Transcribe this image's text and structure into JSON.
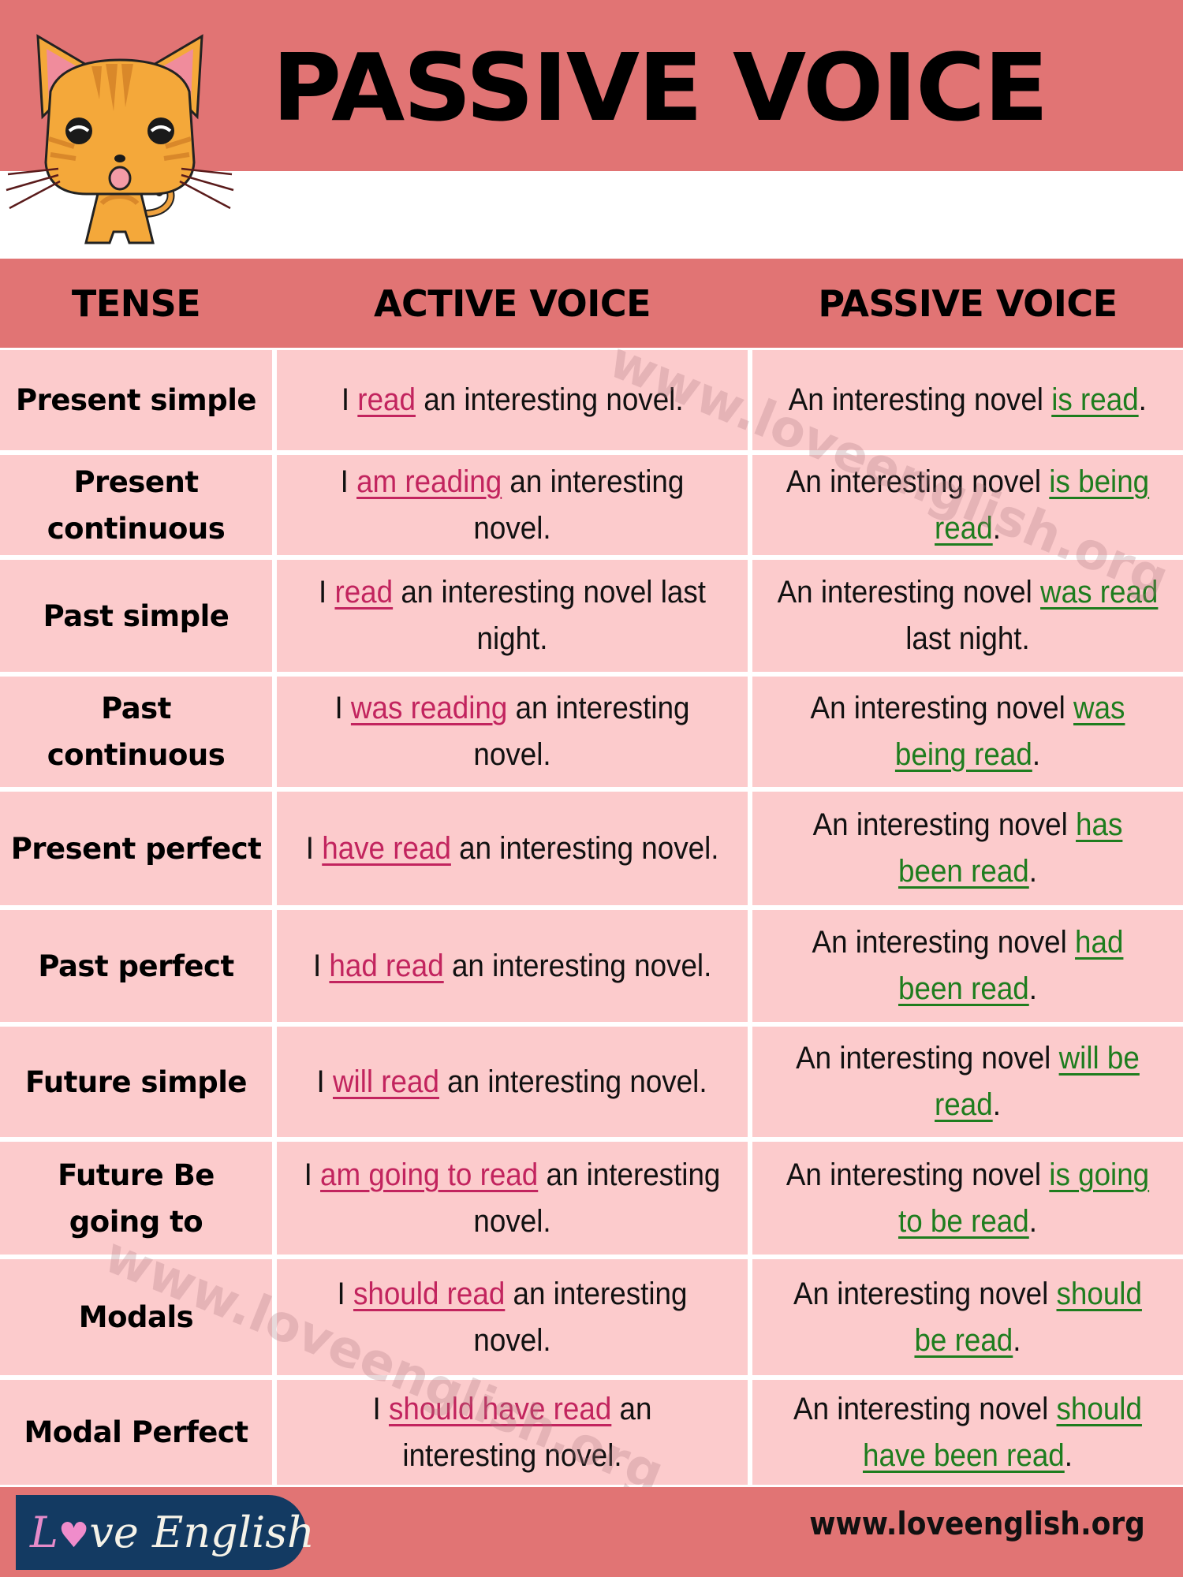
{
  "header": {
    "title": "PASSIVE VOICE",
    "mascot": "cat-mascot-icon"
  },
  "table": {
    "columns": [
      "TENSE",
      "ACTIVE VOICE",
      "PASSIVE VOICE"
    ],
    "rows": [
      {
        "tense": "Present simple",
        "active": [
          {
            "t": "I "
          },
          {
            "t": "read",
            "hl": true
          },
          {
            "t": " an interesting novel."
          }
        ],
        "passive": [
          {
            "t": "An interesting novel "
          },
          {
            "t": "is read",
            "hl": true
          },
          {
            "t": "."
          }
        ]
      },
      {
        "tense": "Present continuous",
        "active": [
          {
            "t": "I "
          },
          {
            "t": "am reading",
            "hl": true
          },
          {
            "t": " an interesting novel."
          }
        ],
        "passive": [
          {
            "t": "An interesting novel "
          },
          {
            "t": "is being read",
            "hl": true
          },
          {
            "t": "."
          }
        ]
      },
      {
        "tense": "Past simple",
        "active": [
          {
            "t": "I "
          },
          {
            "t": "read",
            "hl": true
          },
          {
            "t": " an interesting novel last night."
          }
        ],
        "passive": [
          {
            "t": "An interesting novel "
          },
          {
            "t": "was read",
            "hl": true
          },
          {
            "t": " last night."
          }
        ]
      },
      {
        "tense": "Past continuous",
        "active": [
          {
            "t": "I "
          },
          {
            "t": "was reading",
            "hl": true
          },
          {
            "t": " an interesting novel."
          }
        ],
        "passive": [
          {
            "t": "An interesting novel "
          },
          {
            "t": "was being read",
            "hl": true
          },
          {
            "t": "."
          }
        ]
      },
      {
        "tense": "Present perfect",
        "active": [
          {
            "t": "I "
          },
          {
            "t": "have read",
            "hl": true
          },
          {
            "t": " an interesting novel."
          }
        ],
        "passive": [
          {
            "t": "An interesting novel "
          },
          {
            "t": "has been read",
            "hl": true
          },
          {
            "t": "."
          }
        ]
      },
      {
        "tense": "Past perfect",
        "active": [
          {
            "t": "I "
          },
          {
            "t": "had read",
            "hl": true
          },
          {
            "t": " an interesting novel."
          }
        ],
        "passive": [
          {
            "t": "An interesting novel "
          },
          {
            "t": "had been read",
            "hl": true
          },
          {
            "t": "."
          }
        ]
      },
      {
        "tense": "Future simple",
        "active": [
          {
            "t": "I "
          },
          {
            "t": "will read",
            "hl": true
          },
          {
            "t": " an interesting novel."
          }
        ],
        "passive": [
          {
            "t": "An interesting novel "
          },
          {
            "t": "will be read",
            "hl": true
          },
          {
            "t": "."
          }
        ]
      },
      {
        "tense": "Future Be going to",
        "active": [
          {
            "t": "I "
          },
          {
            "t": "am going to read",
            "hl": true
          },
          {
            "t": " an interesting novel."
          }
        ],
        "passive": [
          {
            "t": "An interesting novel "
          },
          {
            "t": "is going to be read",
            "hl": true
          },
          {
            "t": "."
          }
        ]
      },
      {
        "tense": "Modals",
        "active": [
          {
            "t": "I "
          },
          {
            "t": "should read",
            "hl": true
          },
          {
            "t": " an interesting novel."
          }
        ],
        "passive": [
          {
            "t": "An interesting novel "
          },
          {
            "t": "should be read",
            "hl": true
          },
          {
            "t": "."
          }
        ]
      },
      {
        "tense": "Modal Perfect",
        "active": [
          {
            "t": "I "
          },
          {
            "t": "should have read",
            "hl": true
          },
          {
            "t": " an interesting novel."
          }
        ],
        "passive": [
          {
            "t": "An interesting novel "
          },
          {
            "t": "should have been read",
            "hl": true
          },
          {
            "t": "."
          }
        ]
      }
    ]
  },
  "watermark": "www.loveenglish.org",
  "footer": {
    "logo_l": "L",
    "logo_heart": "♥",
    "logo_rest": "ve English",
    "website": "www.loveenglish.org"
  },
  "colors": {
    "band": "#E17474",
    "cell": "#FCCBCC",
    "active_highlight": "#C2245E",
    "passive_highlight": "#1E7D1E",
    "logo_bg": "#133A62"
  }
}
